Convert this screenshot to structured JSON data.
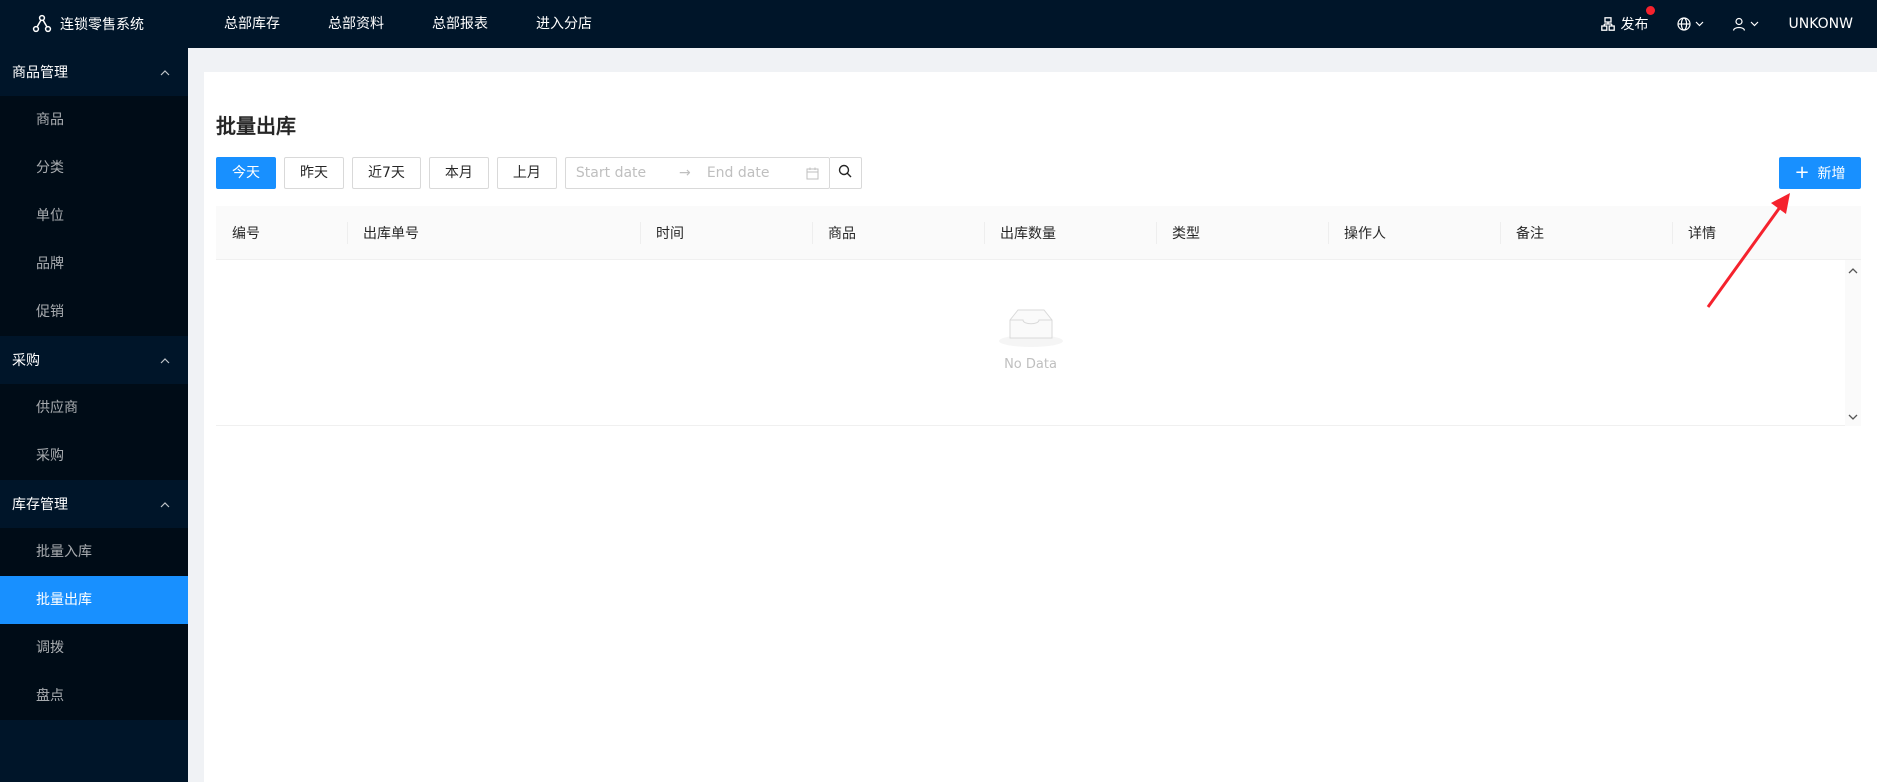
{
  "app": {
    "title": "连锁零售系统"
  },
  "topnav": [
    {
      "label": "总部库存"
    },
    {
      "label": "总部资料"
    },
    {
      "label": "总部报表"
    },
    {
      "label": "进入分店"
    }
  ],
  "header_right": {
    "publish_label": "发布",
    "user_name": "UNKONW"
  },
  "sidebar": {
    "groups": [
      {
        "title": "商品管理",
        "items": [
          {
            "label": "商品"
          },
          {
            "label": "分类"
          },
          {
            "label": "单位"
          },
          {
            "label": "品牌"
          },
          {
            "label": "促销"
          }
        ]
      },
      {
        "title": "采购",
        "items": [
          {
            "label": "供应商"
          },
          {
            "label": "采购"
          }
        ]
      },
      {
        "title": "库存管理",
        "items": [
          {
            "label": "批量入库"
          },
          {
            "label": "批量出库",
            "active": true
          },
          {
            "label": "调拨"
          },
          {
            "label": "盘点"
          }
        ]
      }
    ]
  },
  "page": {
    "title": "批量出库",
    "filters": [
      "今天",
      "昨天",
      "近7天",
      "本月",
      "上月"
    ],
    "date_start_placeholder": "Start date",
    "date_end_placeholder": "End date",
    "date_separator": "→",
    "add_label": "新增"
  },
  "table": {
    "columns": [
      "编号",
      "出库单号",
      "时间",
      "商品",
      "出库数量",
      "类型",
      "操作人",
      "备注",
      "详情"
    ],
    "rows": [],
    "empty_text": "No Data"
  },
  "colors": {
    "primary": "#1890ff",
    "nav_bg": "#001529",
    "annotation": "#f5222d"
  },
  "icons": {
    "logo": "share-nodes-icon",
    "publish": "cluster-icon",
    "language": "globe-icon",
    "user": "user-icon",
    "calendar": "calendar-icon",
    "search": "search-icon",
    "empty": "inbox-icon",
    "add": "plus-icon"
  }
}
